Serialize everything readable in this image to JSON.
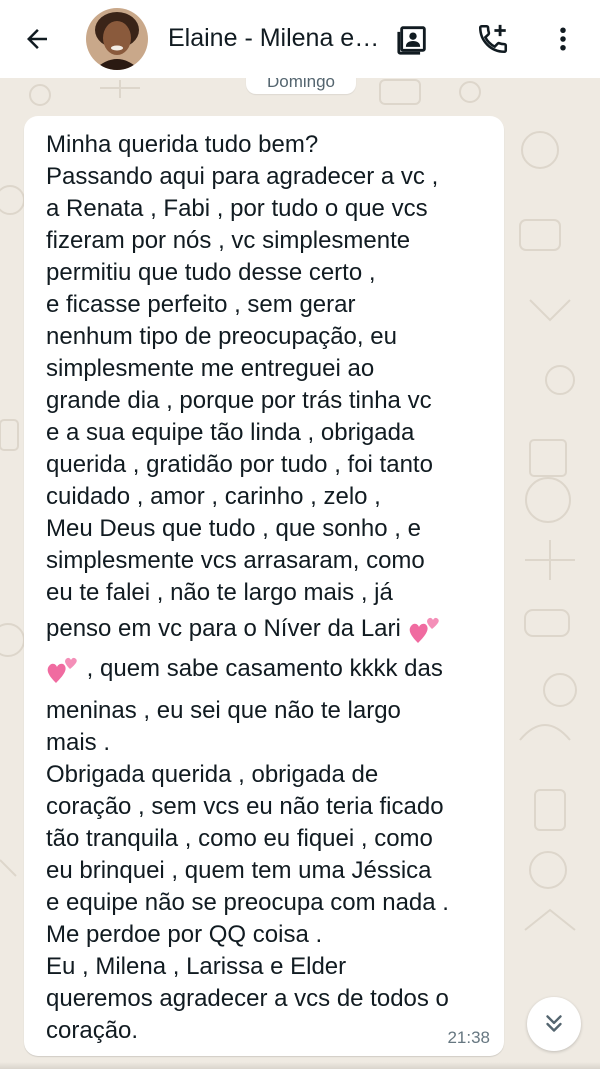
{
  "header": {
    "contact_name": "Elaine - Milena e Larissa",
    "icons": [
      "back-arrow-icon",
      "contact-card-icon",
      "add-call-icon",
      "more-vert-icon"
    ]
  },
  "date_label": "Domingo",
  "message": {
    "lines": [
      "Minha querida tudo bem?",
      "Passando aqui para agradecer a vc ,",
      "a Renata , Fabi , por tudo o que vcs",
      "fizeram por nós , vc simplesmente",
      "permitiu que tudo desse certo ,",
      "e ficasse perfeito , sem gerar",
      "nenhum tipo de preocupação, eu",
      "simplesmente me entreguei ao",
      "grande dia , porque por trás tinha vc",
      "e a sua equipe tão linda , obrigada",
      "querida , gratidão por tudo , foi tanto",
      "cuidado , amor , carinho , zelo ,",
      "Meu Deus que tudo , que sonho , e",
      "simplesmente vcs arrasaram, como",
      "eu te falei , não te largo mais , já",
      "penso em vc para o Níver da Lari",
      ", quem sabe casamento kkkk das",
      "meninas , eu sei que não te largo",
      "mais .",
      "Obrigada querida , obrigada de",
      "coração , sem vcs eu não teria ficado",
      "tão tranquila , como eu fiquei , como",
      "eu brinquei , quem tem uma Jéssica",
      "e equipe não se preocupa com nada .",
      "Me perdoe por QQ coisa .",
      "Eu , Milena , Larissa e Elder",
      "queremos agradecer a vcs de todos o",
      "coração."
    ],
    "emoji": "two-hearts-emoji",
    "time": "21:38"
  },
  "colors": {
    "background": "#efeae2",
    "bubble": "#ffffff",
    "text": "#111b21",
    "meta_text": "#667781",
    "heart_pink": "#f06ba0"
  }
}
